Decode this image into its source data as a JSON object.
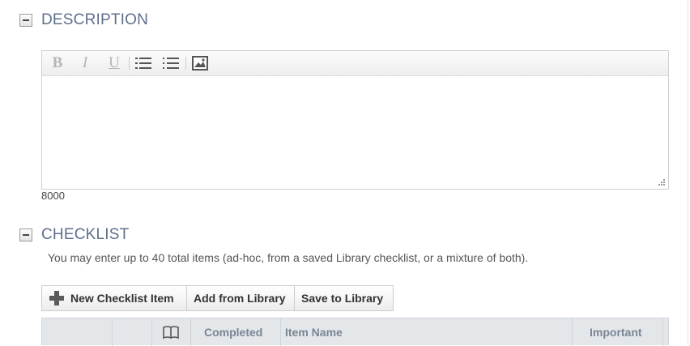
{
  "description": {
    "title": "DESCRIPTION",
    "toolbar": {
      "bold": "B",
      "italic": "I",
      "underline": "U",
      "ordered_list_icon": "ordered-list-icon",
      "unordered_list_icon": "unordered-list-icon",
      "image_icon": "image-icon"
    },
    "content": "",
    "char_count": "8000"
  },
  "checklist": {
    "title": "CHECKLIST",
    "note": "You may enter up to 40 total items (ad-hoc, from a saved Library checklist, or a mixture of both).",
    "buttons": {
      "new_item": "New Checklist Item",
      "add_from_library": "Add from Library",
      "save_to_library": "Save to Library"
    },
    "columns": {
      "col1": "",
      "col2": "",
      "library_icon": "book-icon",
      "completed": "Completed",
      "item_name": "Item Name",
      "important": "Important"
    }
  },
  "colors": {
    "section_title": "#5f6f8c",
    "header_bg": "#e4e7ea",
    "header_text": "#7a8594"
  }
}
